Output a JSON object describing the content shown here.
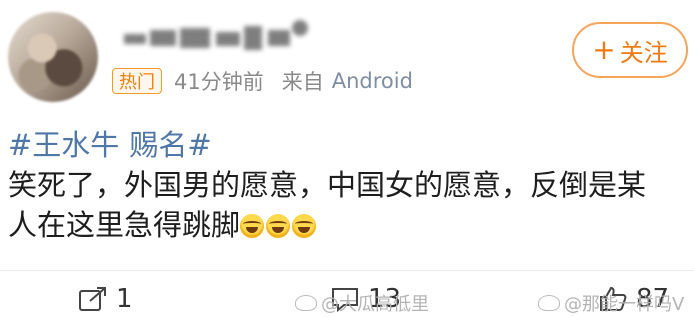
{
  "header": {
    "badge": "热门",
    "time": "41分钟前",
    "from_label": "来自",
    "source": "Android",
    "follow_label": "关注",
    "follow_icon": "plus-icon"
  },
  "post": {
    "hashtags": [
      "#王水牛",
      "赐名#"
    ],
    "text_line1": "笑死了，外国男的愿意，中国女的愿意，反倒是某",
    "text_line2": "人在这里急得跳脚"
  },
  "actions": {
    "share_count": "1",
    "comment_count": "13",
    "like_count": "87"
  },
  "watermarks": {
    "left": "@大瓜高低里",
    "right": "@那能一样吗V"
  },
  "colors": {
    "accent": "#f07a12",
    "link": "#4f77a8",
    "meta": "#8a8a8a"
  }
}
